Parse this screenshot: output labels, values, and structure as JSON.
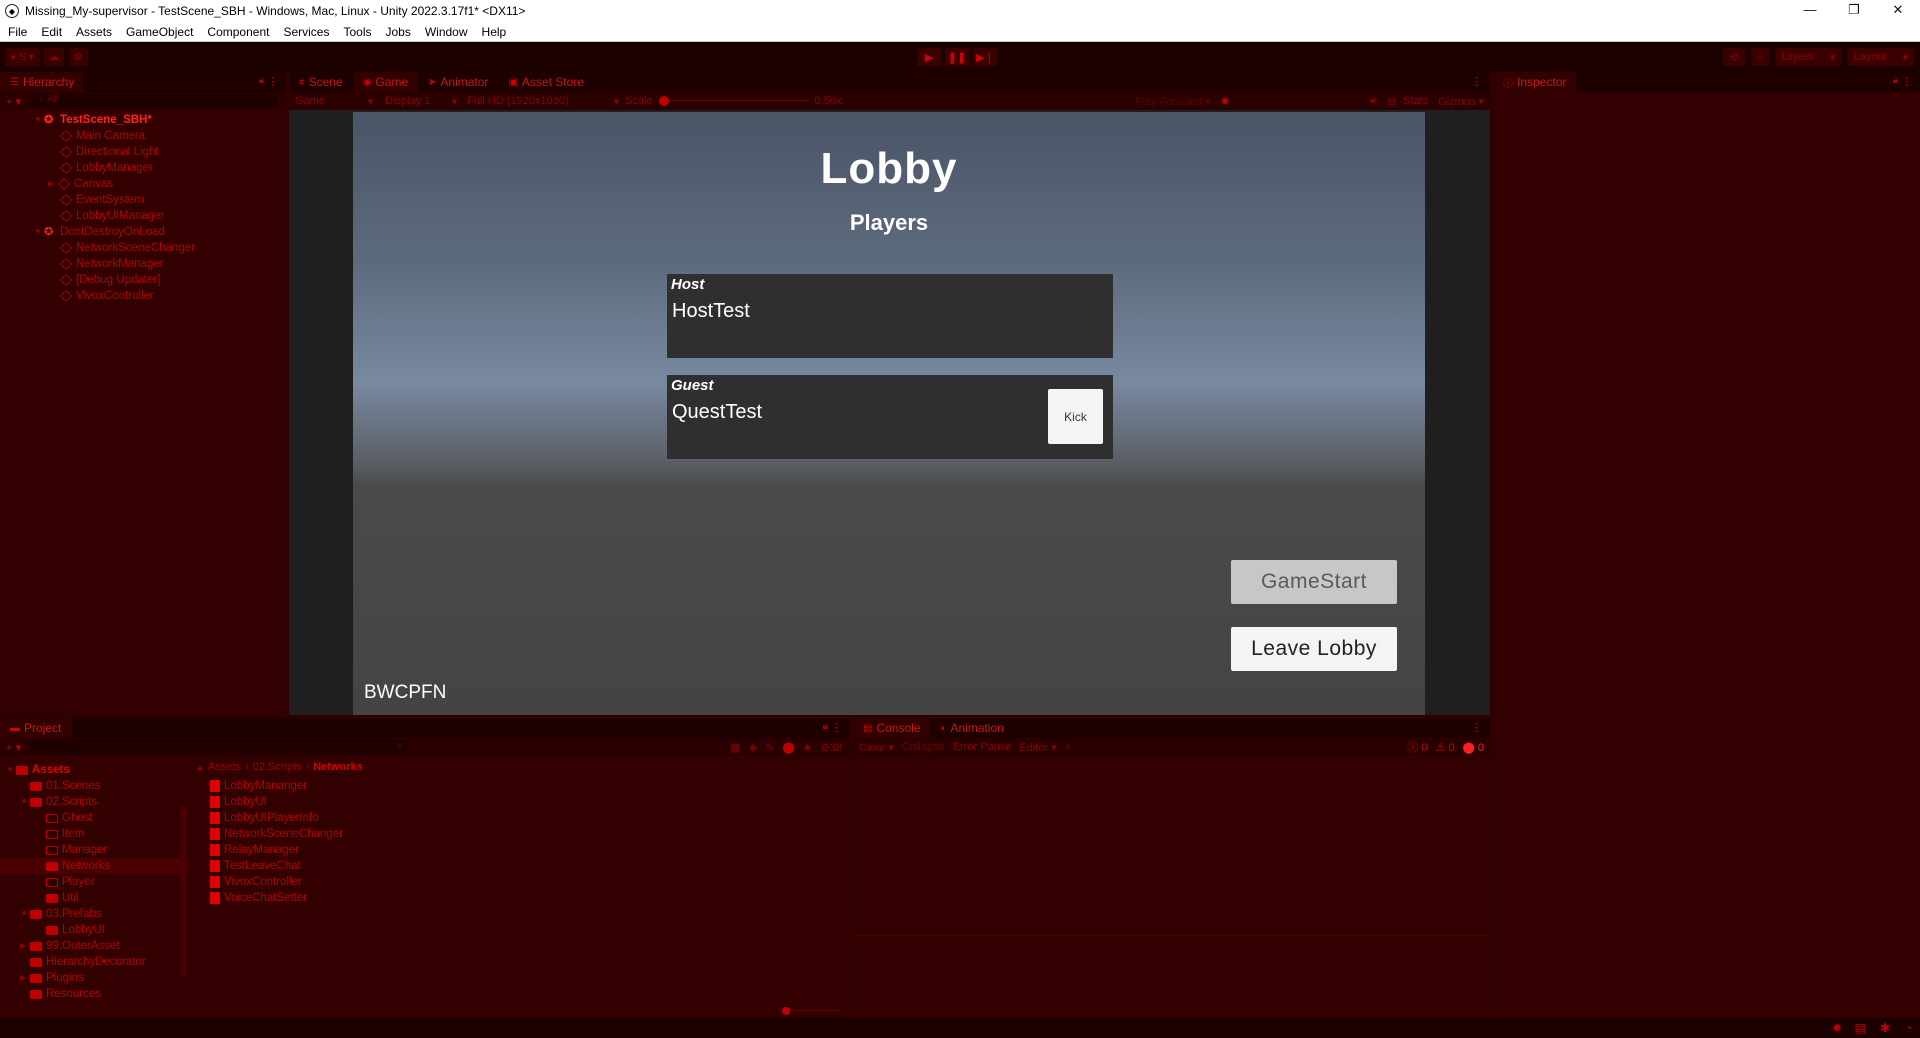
{
  "window": {
    "title": "Missing_My-supervisor - TestScene_SBH - Windows, Mac, Linux - Unity 2022.3.17f1* <DX11>"
  },
  "menu": [
    "File",
    "Edit",
    "Assets",
    "GameObject",
    "Component",
    "Services",
    "Tools",
    "Jobs",
    "Window",
    "Help"
  ],
  "toolbar": {
    "account": "S",
    "layers": "Layers",
    "layout": "Layout"
  },
  "hierarchy": {
    "tab": "Hierarchy",
    "search_placeholder": "All",
    "scene": "TestScene_SBH*",
    "scene_children": [
      "Main Camera",
      "Directional Light",
      "LobbyManager",
      "Canvas",
      "EventSystem",
      "LobbyUIManager"
    ],
    "ddol": "DontDestroyOnLoad",
    "ddol_children": [
      "NetworkSceneChanger",
      "NetworkManager",
      "[Debug Updater]",
      "VivoxController"
    ]
  },
  "center_tabs": [
    "Scene",
    "Game",
    "Animator",
    "Asset Store"
  ],
  "game_bar": {
    "mode": "Game",
    "display": "Display 1",
    "resolution": "Full HD (1920x1080)",
    "scale_label": "Scale",
    "scale_value": "0.56x",
    "play_focused": "Play Focused",
    "stats": "Stats",
    "gizmos": "Gizmos"
  },
  "game": {
    "title": "Lobby",
    "subtitle": "Players",
    "host_role": "Host",
    "host_name": "HostTest",
    "guest_role": "Guest",
    "guest_name": "QuestTest",
    "kick": "Kick",
    "game_start": "GameStart",
    "leave_lobby": "Leave Lobby",
    "room_code": "BWCPFN"
  },
  "inspector": {
    "tab": "Inspector"
  },
  "project": {
    "tab": "Project",
    "hidden_count": "38",
    "breadcrumb": [
      "Assets",
      "02.Scripts",
      "Networks"
    ],
    "tree": [
      {
        "label": "Assets",
        "depth": 0,
        "arrow": "▼",
        "bold": true
      },
      {
        "label": "01.Scenes",
        "depth": 1,
        "arrow": ""
      },
      {
        "label": "02.Scripts",
        "depth": 1,
        "arrow": "▼"
      },
      {
        "label": "Ghost",
        "depth": 2,
        "arrow": "",
        "empty": true
      },
      {
        "label": "Item",
        "depth": 2,
        "arrow": "",
        "empty": true
      },
      {
        "label": "Manager",
        "depth": 2,
        "arrow": "",
        "empty": true
      },
      {
        "label": "Networks",
        "depth": 2,
        "arrow": "",
        "selected": true
      },
      {
        "label": "Player",
        "depth": 2,
        "arrow": "",
        "empty": true
      },
      {
        "label": "Util",
        "depth": 2,
        "arrow": ""
      },
      {
        "label": "03.Prefabs",
        "depth": 1,
        "arrow": "▼"
      },
      {
        "label": "LobbyUI",
        "depth": 2,
        "arrow": ""
      },
      {
        "label": "99.OuterAsset",
        "depth": 1,
        "arrow": "▶"
      },
      {
        "label": "HierarchyDecorator",
        "depth": 1,
        "arrow": ""
      },
      {
        "label": "Plugins",
        "depth": 1,
        "arrow": "▶"
      },
      {
        "label": "Resources",
        "depth": 1,
        "arrow": ""
      }
    ],
    "files": [
      "LobbyMananger",
      "LobbyUI",
      "LobbyUIPlayerInfo",
      "NetworkSceneChanger",
      "RelayManager",
      "TestLeaveChat",
      "VivoxController",
      "VoiceChatSetter"
    ]
  },
  "console": {
    "tabs": [
      "Console",
      "Animation"
    ],
    "clear": "Clear",
    "collapse": "Collapse",
    "error_pause": "Error Pause",
    "editor": "Editor",
    "log_count": "0",
    "warn_count": "0",
    "error_count": "0"
  },
  "colors": {
    "accent": "#d40000",
    "panel": "#330000",
    "text": "#b40000"
  }
}
